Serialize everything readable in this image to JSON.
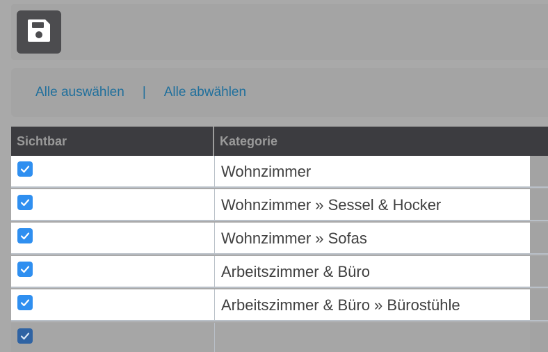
{
  "toolbar": {
    "save_icon": "floppy-disk-icon"
  },
  "select_bar": {
    "select_all": "Alle auswählen",
    "separator": "|",
    "deselect_all": "Alle abwählen"
  },
  "table": {
    "headers": {
      "visible": "Sichtbar",
      "category": "Kategorie"
    },
    "rows": [
      {
        "checked": true,
        "category": "Wohnzimmer"
      },
      {
        "checked": true,
        "category": "Wohnzimmer » Sessel & Hocker"
      },
      {
        "checked": true,
        "category": "Wohnzimmer » Sofas"
      },
      {
        "checked": true,
        "category": "Arbeitszimmer & Büro"
      },
      {
        "checked": true,
        "category": "Arbeitszimmer & Büro » Bürostühle"
      },
      {
        "checked": true,
        "category": ""
      }
    ]
  },
  "colors": {
    "accent": "#2f8ff0",
    "link": "#1f6f9c",
    "header_bg": "#3c3c40"
  }
}
